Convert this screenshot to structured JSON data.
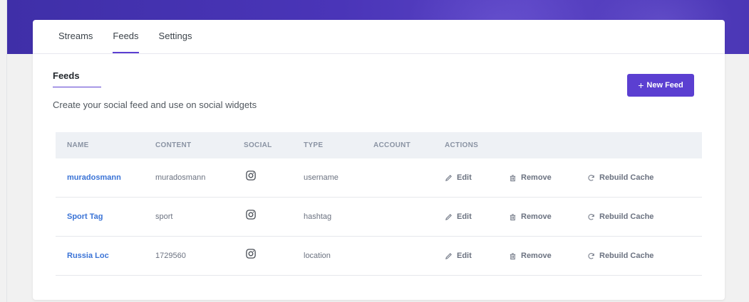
{
  "tabs": [
    {
      "label": "Streams",
      "active": false
    },
    {
      "label": "Feeds",
      "active": true
    },
    {
      "label": "Settings",
      "active": false
    }
  ],
  "section": {
    "title": "Feeds",
    "subtitle": "Create your social feed and use on social widgets"
  },
  "new_feed_button": {
    "plus": "+",
    "label": "New Feed"
  },
  "table": {
    "headers": [
      "NAME",
      "CONTENT",
      "SOCIAL",
      "TYPE",
      "ACCOUNT",
      "ACTIONS"
    ],
    "rows": [
      {
        "name": "muradosmann",
        "content": "muradosmann",
        "social": "instagram-icon",
        "type": "username",
        "account": ""
      },
      {
        "name": "Sport Tag",
        "content": "sport",
        "social": "instagram-icon",
        "type": "hashtag",
        "account": ""
      },
      {
        "name": "Russia Loc",
        "content": "1729560",
        "social": "instagram-icon",
        "type": "location",
        "account": ""
      }
    ],
    "actions": {
      "edit": "Edit",
      "remove": "Remove",
      "rebuild": "Rebuild Cache"
    }
  },
  "colors": {
    "accent": "#5b3fd1",
    "header_band": "#4a35b8",
    "link": "#3a73d6",
    "table_header_bg": "#eef1f5"
  }
}
